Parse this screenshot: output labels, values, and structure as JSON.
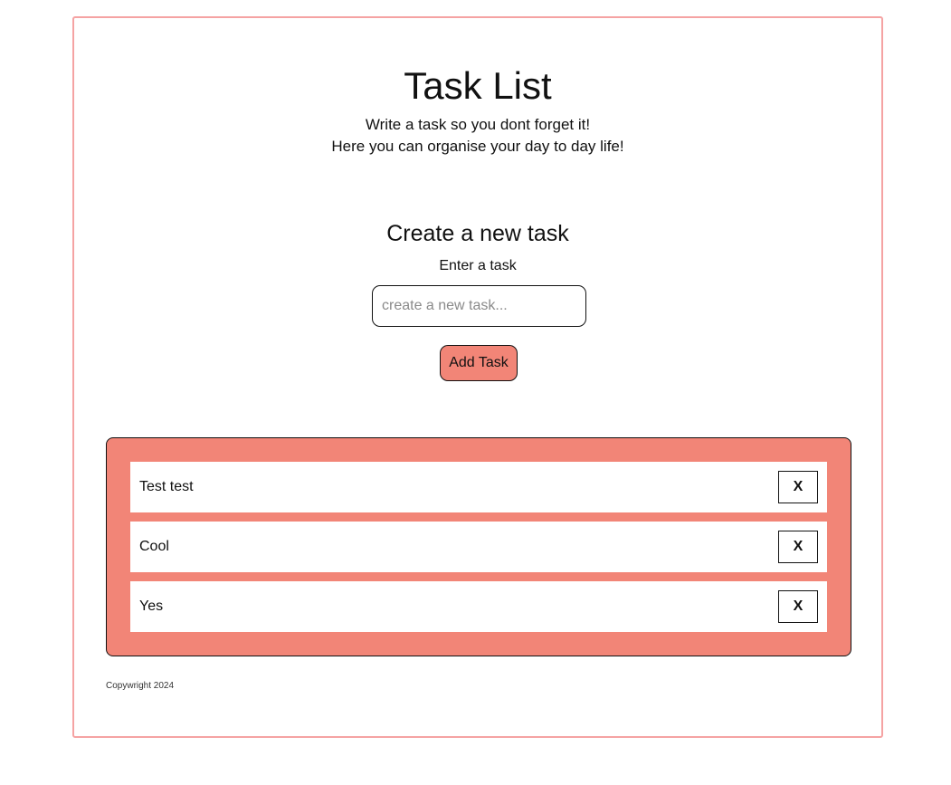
{
  "header": {
    "title": "Task List",
    "subtitle_line1": "Write a task so you dont forget it!",
    "subtitle_line2": "Here you can organise your day to day life!"
  },
  "create": {
    "heading": "Create a new task",
    "input_label": "Enter a task",
    "input_placeholder": "create a new task...",
    "input_value": "",
    "add_button_label": "Add Task"
  },
  "tasks": [
    {
      "text": "Test test",
      "delete_label": "X"
    },
    {
      "text": "Cool",
      "delete_label": "X"
    },
    {
      "text": "Yes",
      "delete_label": "X"
    }
  ],
  "footer": {
    "text": "Copywright 2024"
  },
  "colors": {
    "accent": "#f28577",
    "frame_border": "#f5a3a3",
    "text": "#111111"
  }
}
